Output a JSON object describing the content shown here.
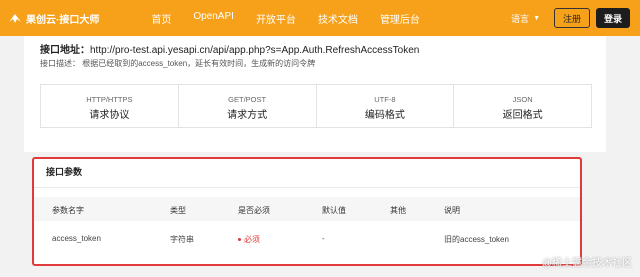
{
  "brand": {
    "name": "果创云·接口大师"
  },
  "nav": [
    "首页",
    "OpenAPI",
    "开放平台",
    "技术文档",
    "管理后台"
  ],
  "lang": {
    "label": "语言"
  },
  "auth": {
    "register": "注册",
    "login": "登录"
  },
  "endpoint": {
    "label": "接口地址：",
    "url": "http://pro-test.api.yesapi.cn/api/app.php?s=App.Auth.RefreshAccessToken",
    "desc": "接口描述： 根据已经取到的access_token，延长有效时间，生成新的访问令牌"
  },
  "attributes": [
    {
      "top": "HTTP/HTTPS",
      "bottom": "请求协议"
    },
    {
      "top": "GET/POST",
      "bottom": "请求方式"
    },
    {
      "top": "UTF-8",
      "bottom": "编码格式"
    },
    {
      "top": "JSON",
      "bottom": "返回格式"
    }
  ],
  "params": {
    "title": "接口参数",
    "headers": [
      "参数名字",
      "类型",
      "是否必须",
      "默认值",
      "其他",
      "说明"
    ],
    "rows": [
      {
        "name": "access_token",
        "type": "字符串",
        "required": "必须",
        "default": "-",
        "other": "",
        "note": "旧的access_token"
      }
    ]
  },
  "watermark": "@稀土掘金技术社区"
}
